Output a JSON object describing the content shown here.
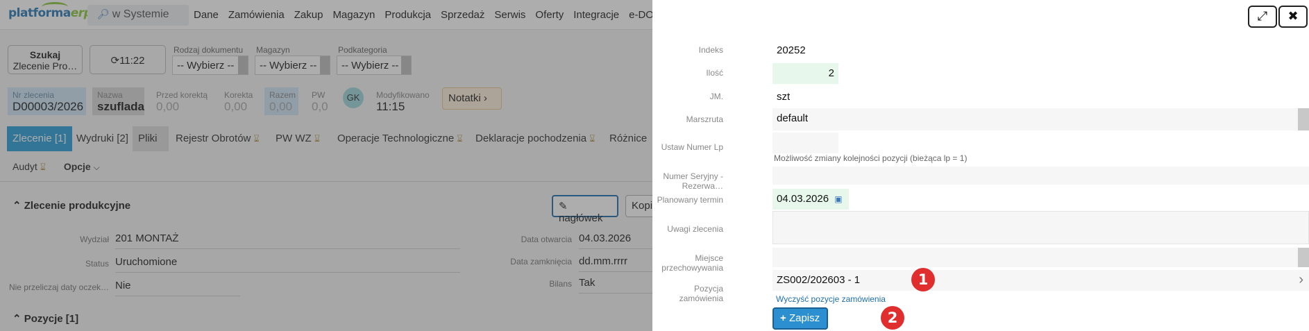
{
  "app": {
    "logo_main": "platforma",
    "logo_accent": "erp"
  },
  "topbar": {
    "search_label": "w Systemie",
    "menu": [
      "Dane",
      "Zamówienia",
      "Zakup",
      "Magazyn",
      "Produkcja",
      "Sprzedaż",
      "Serwis",
      "Oferty",
      "Integracje",
      "e-DOK"
    ]
  },
  "toolbar": {
    "search_button_line1": "Szukaj",
    "search_button_line2": "Zlecenie Pro…",
    "refresh_time": "11:22",
    "filters": [
      {
        "label": "Rodzaj dokumentu",
        "value": "-- Wybierz --"
      },
      {
        "label": "Magazyn",
        "value": "-- Wybierz --"
      },
      {
        "label": "Podkategoria",
        "value": "-- Wybierz --"
      }
    ]
  },
  "doc_info": {
    "nr_label": "Nr zlecenia",
    "nr_value": "D00003/2026",
    "nazwa_label": "Nazwa",
    "nazwa_value": "szuflada",
    "przed_label": "Przed korektą",
    "przed_value": "0,00",
    "korekta_label": "Korekta",
    "korekta_value": "0,00",
    "razem_label": "Razem",
    "razem_value": "0,00",
    "pw_label": "PW",
    "pw_value": "0,0",
    "avatar": "GK",
    "modyf_label": "Modyfikowano",
    "modyf_value": "11:15",
    "notatki": "Notatki"
  },
  "tabs": [
    "Zlecenie [1]",
    "Wydruki [2]",
    "Pliki",
    "Rejestr Obrotów",
    "PW WZ",
    "Operacje Technologiczne",
    "Deklaracje pochodzenia",
    "Różnice"
  ],
  "subtabs": {
    "audyt": "Audyt",
    "opcje": "Opcje"
  },
  "section": {
    "title": "Zlecenie produkcyjne",
    "naglowek_button": "nagłówek",
    "kopi_button": "Kopi",
    "fields": {
      "wydzial_label": "Wydział",
      "wydzial_value": "201 MONTAŻ",
      "status_label": "Status",
      "status_value": "Uruchomione",
      "nieprzel_label": "Nie przeliczaj daty oczek…",
      "nieprzel_value": "Nie",
      "data_otw_label": "Data otwarcia",
      "data_otw_value": "04.03.2026",
      "data_zam_label": "Data zamknięcia",
      "data_zam_value": "dd.mm.rrrr",
      "bilans_label": "Bilans",
      "bilans_value": "Tak"
    },
    "pozycje_title": "Pozycje [1]"
  },
  "panel": {
    "indeks_label": "Indeks",
    "indeks_value": "20252",
    "ilosc_label": "Ilość",
    "ilosc_value": "2",
    "jm_label": "JM.",
    "jm_value": "szt",
    "marszruta_label": "Marszruta",
    "marszruta_value": "default",
    "ustaw_label": "Ustaw Numer Lp",
    "ustaw_value": "",
    "ustaw_hint": "Możliwość zmiany kolejności pozycji (bieżąca lp = 1)",
    "seryjny_label": "Numer Seryjny - Rezerwa…",
    "seryjny_value": "",
    "termin_label": "Planowany termin",
    "termin_value": "04.03.2026",
    "uwagi_label": "Uwagi zlecenia",
    "uwagi_value": "",
    "miejsce_label": "Miejsce przechowywania",
    "miejsce_value": "",
    "pozycja_label": "Pozycja zamówienia",
    "pozycja_value": "ZS002/202603 - 1",
    "wyczysc_link": "Wyczyść pozycje zamówienia",
    "zapisz_button": "Zapisz",
    "badge1": "1",
    "badge2": "2"
  },
  "colors": {
    "accent": "#2b9fd8",
    "badge": "#e02e2e",
    "overlay": "rgba(60,60,60,0.42)"
  }
}
